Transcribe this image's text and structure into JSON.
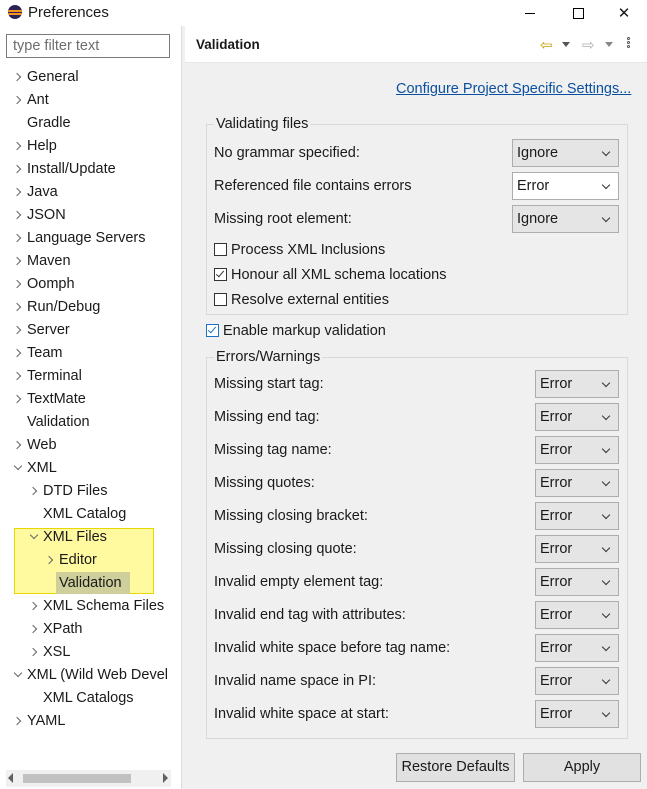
{
  "window": {
    "title": "Preferences",
    "min_glyph": "",
    "close_glyph": "✕"
  },
  "filter": {
    "placeholder": "type filter text"
  },
  "tree": [
    {
      "label": "General",
      "level": 0,
      "toggle": "collapsed"
    },
    {
      "label": "Ant",
      "level": 0,
      "toggle": "collapsed"
    },
    {
      "label": "Gradle",
      "level": 0,
      "toggle": "none"
    },
    {
      "label": "Help",
      "level": 0,
      "toggle": "collapsed"
    },
    {
      "label": "Install/Update",
      "level": 0,
      "toggle": "collapsed"
    },
    {
      "label": "Java",
      "level": 0,
      "toggle": "collapsed"
    },
    {
      "label": "JSON",
      "level": 0,
      "toggle": "collapsed"
    },
    {
      "label": "Language Servers",
      "level": 0,
      "toggle": "collapsed"
    },
    {
      "label": "Maven",
      "level": 0,
      "toggle": "collapsed"
    },
    {
      "label": "Oomph",
      "level": 0,
      "toggle": "collapsed"
    },
    {
      "label": "Run/Debug",
      "level": 0,
      "toggle": "collapsed"
    },
    {
      "label": "Server",
      "level": 0,
      "toggle": "collapsed"
    },
    {
      "label": "Team",
      "level": 0,
      "toggle": "collapsed"
    },
    {
      "label": "Terminal",
      "level": 0,
      "toggle": "collapsed"
    },
    {
      "label": "TextMate",
      "level": 0,
      "toggle": "collapsed"
    },
    {
      "label": "Validation",
      "level": 0,
      "toggle": "none"
    },
    {
      "label": "Web",
      "level": 0,
      "toggle": "collapsed"
    },
    {
      "label": "XML",
      "level": 0,
      "toggle": "expanded"
    },
    {
      "label": "DTD Files",
      "level": 1,
      "toggle": "collapsed"
    },
    {
      "label": "XML Catalog",
      "level": 1,
      "toggle": "none"
    },
    {
      "label": "XML Files",
      "level": 1,
      "toggle": "expanded"
    },
    {
      "label": "Editor",
      "level": 2,
      "toggle": "collapsed"
    },
    {
      "label": "Validation",
      "level": 2,
      "toggle": "none",
      "selected": true
    },
    {
      "label": "XML Schema Files",
      "level": 1,
      "toggle": "collapsed"
    },
    {
      "label": "XPath",
      "level": 1,
      "toggle": "collapsed"
    },
    {
      "label": "XSL",
      "level": 1,
      "toggle": "collapsed"
    },
    {
      "label": "XML (Wild Web Devel",
      "level": 0,
      "toggle": "expanded"
    },
    {
      "label": "XML Catalogs",
      "level": 1,
      "toggle": "none"
    },
    {
      "label": "YAML",
      "level": 0,
      "toggle": "collapsed"
    }
  ],
  "page": {
    "title": "Validation",
    "project_link": "Configure Project Specific Settings...",
    "validating_files": {
      "title": "Validating files",
      "rows": [
        {
          "label": "No grammar specified:",
          "value": "Ignore"
        },
        {
          "label": "Referenced file contains errors",
          "value": "Error"
        },
        {
          "label": "Missing root element:",
          "value": "Ignore"
        }
      ],
      "checkboxes": [
        {
          "label": "Process XML Inclusions",
          "checked": false
        },
        {
          "label": "Honour all XML schema locations",
          "checked": true
        },
        {
          "label": "Resolve external entities",
          "checked": false
        }
      ]
    },
    "markup_validation": {
      "label": "Enable markup validation",
      "checked": true
    },
    "errors_warnings": {
      "title": "Errors/Warnings",
      "rows": [
        {
          "label": "Missing start tag:",
          "value": "Error"
        },
        {
          "label": "Missing end tag:",
          "value": "Error"
        },
        {
          "label": "Missing tag name:",
          "value": "Error"
        },
        {
          "label": "Missing quotes:",
          "value": "Error"
        },
        {
          "label": "Missing closing bracket:",
          "value": "Error"
        },
        {
          "label": "Missing closing quote:",
          "value": "Error"
        },
        {
          "label": "Invalid empty element tag:",
          "value": "Error"
        },
        {
          "label": "Invalid end tag with attributes:",
          "value": "Error"
        },
        {
          "label": "Invalid white space before tag name:",
          "value": "Error"
        },
        {
          "label": "Invalid name space in PI:",
          "value": "Error"
        },
        {
          "label": "Invalid white space at start:",
          "value": "Error"
        }
      ]
    }
  },
  "buttons": {
    "restore": "Restore Defaults",
    "apply": "Apply"
  },
  "colors": {
    "highlight": "#fff9a0",
    "link": "#0b50a0",
    "dialog_bg": "#f0f0f0"
  }
}
